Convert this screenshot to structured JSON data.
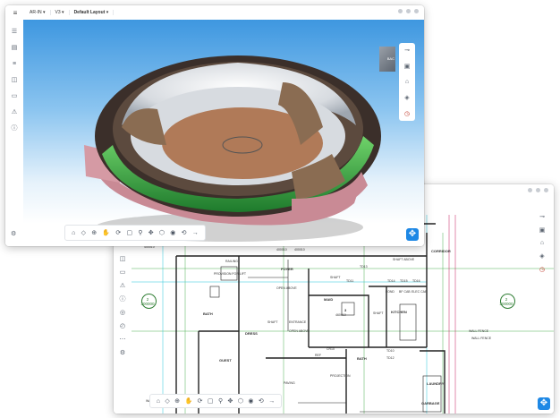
{
  "front_window": {
    "menu_icon": "hamburger-icon",
    "dropdowns": [
      {
        "label": "AR-IN"
      },
      {
        "label": "V3"
      },
      {
        "label": "Default Layout"
      }
    ],
    "left_icons": [
      "layers-icon",
      "stack-icon",
      "list-icon",
      "cube-icon",
      "folder-icon",
      "warning-icon",
      "info-icon"
    ],
    "bottom_left_icon": "settings-icon",
    "right_tools": [
      "measure-icon",
      "layers-icon",
      "home-icon",
      "section-icon",
      "history-icon"
    ],
    "view_cube_label": "BAC",
    "bottom_toolbar": [
      "home-icon",
      "box-icon",
      "zoom-icon",
      "pan-icon",
      "orbit-icon",
      "screenshot-icon",
      "walk-icon",
      "move-icon",
      "cube-3d-icon",
      "camera-icon",
      "reset-icon",
      "arrow-icon"
    ],
    "corner_button": "expand-icon",
    "colors": {
      "sky_top": "#3e97e0",
      "sky_bottom": "#e6f2fb",
      "facade_green": "#3ea84b",
      "roof_pink": "#c98a95"
    }
  },
  "back_window": {
    "left_icons": [
      "layers-icon",
      "stack-icon",
      "grid-icon",
      "list-icon",
      "cube-icon",
      "folder-icon",
      "warning-icon",
      "info-icon",
      "settings-icon"
    ],
    "right_tools": [
      "measure-icon",
      "layers-icon",
      "home-icon",
      "section-icon",
      "history-icon"
    ],
    "corner_button": "expand-icon",
    "plan": {
      "grid_tags": [
        {
          "top": "2",
          "bottom": "300000"
        },
        {
          "top": "2",
          "bottom": "300000"
        }
      ],
      "rooms": [
        {
          "name": "FOYER",
          "area": "GFL-002\n125 m²"
        },
        {
          "name": "MAID",
          "area": "GFL-005\n14.63 m²"
        },
        {
          "name": "KITCHEN",
          "area": "GFL-011\n14.77 m²"
        },
        {
          "name": "BATH",
          "area": "GFL-003\n7.05 m²"
        },
        {
          "name": "DRESS",
          "area": "GFL-004\n12.16 m²"
        },
        {
          "name": "GUEST",
          "area": "GFL-004\n16.03 m²"
        },
        {
          "name": "BATH",
          "area": "GFL-004\n6.11 m²"
        },
        {
          "name": "CORRIDOR",
          "area": "GFL-012\n7.41 m²"
        },
        {
          "name": "LAUNDRY",
          "area": ""
        },
        {
          "name": "GARBAGE",
          "area": ""
        }
      ],
      "annotations": [
        "RAILING",
        "PROVISION FOR LIFT",
        "SHAFT",
        "SHAFT ABOVE",
        "OPEN ABOVE",
        "ENTRANCE",
        "OPEN ABOVE",
        "SHAFT",
        "REF",
        "PROJECTION",
        "PAVING",
        "WALL FENCE",
        "WALL FENCE",
        "FOND",
        "BF CAB",
        "ELEC CAB",
        "CR10",
        "TD13",
        "TD14",
        "TD15",
        "TD11",
        "TD16",
        "TD10",
        "TD12",
        "WALL FENCE",
        "3",
        "460010",
        "400010",
        "400010",
        "400010",
        "SHAFT"
      ],
      "colors": {
        "wall": "#222222",
        "grid_green": "#2e7d32",
        "cyan": "#00bcd4",
        "magenta": "#c2185b"
      }
    },
    "bottom_toolbar": [
      "home-icon",
      "box-icon",
      "zoom-icon",
      "pan-icon",
      "orbit-icon",
      "screenshot-icon",
      "walk-icon",
      "move-icon",
      "cube-3d-icon",
      "camera-icon",
      "reset-icon",
      "arrow-icon"
    ]
  }
}
